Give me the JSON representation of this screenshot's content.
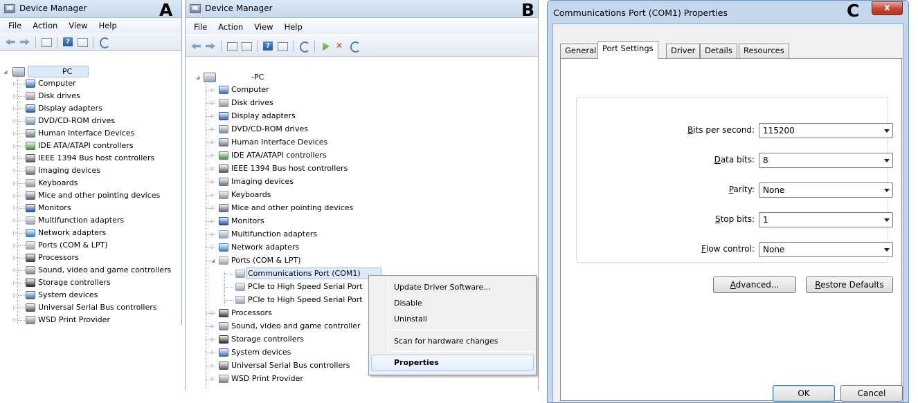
{
  "panels": {
    "a": {
      "letter": "A",
      "title": "Device Manager"
    },
    "b": {
      "letter": "B",
      "title": "Device Manager"
    },
    "c": {
      "letter": "C",
      "title": "Communications Port (COM1) Properties"
    }
  },
  "menu": [
    "File",
    "Action",
    "View",
    "Help"
  ],
  "tree_a": {
    "root": "PC",
    "items": [
      "Computer",
      "Disk drives",
      "Display adapters",
      "DVD/CD-ROM drives",
      "Human Interface Devices",
      "IDE ATA/ATAPI controllers",
      "IEEE 1394 Bus host controllers",
      "Imaging devices",
      "Keyboards",
      "Mice and other pointing devices",
      "Monitors",
      "Multifunction adapters",
      "Network adapters",
      "Ports (COM & LPT)",
      "Processors",
      "Sound, video and game controllers",
      "Storage controllers",
      "System devices",
      "Universal Serial Bus controllers",
      "WSD Print Provider"
    ]
  },
  "tree_b": {
    "root": "-PC",
    "items_before": [
      "Computer",
      "Disk drives",
      "Display adapters",
      "DVD/CD-ROM drives",
      "Human Interface Devices",
      "IDE ATA/ATAPI controllers",
      "IEEE 1394 Bus host controllers",
      "Imaging devices",
      "Keyboards",
      "Mice and other pointing devices",
      "Monitors",
      "Multifunction adapters",
      "Network adapters"
    ],
    "ports": "Ports (COM & LPT)",
    "port_children": [
      "Communications Port (COM1)",
      "PCIe to High Speed Serial Port",
      "PCIe to High Speed Serial Port"
    ],
    "items_after": [
      "Processors",
      "Sound, video and game controller",
      "Storage controllers",
      "System devices",
      "Universal Serial Bus controllers",
      "WSD Print Provider"
    ]
  },
  "context_menu": {
    "update": "Update Driver Software...",
    "disable": "Disable",
    "uninstall": "Uninstall",
    "scan": "Scan for hardware changes",
    "properties": "Properties"
  },
  "dialog": {
    "tabs": [
      "General",
      "Port Settings",
      "Driver",
      "Details",
      "Resources"
    ],
    "active_tab": "Port Settings",
    "fields": [
      {
        "key": "B",
        "rest": "its per second:",
        "value": "115200"
      },
      {
        "key": "D",
        "rest": "ata bits:",
        "value": "8"
      },
      {
        "key": "P",
        "rest": "arity:",
        "value": "None"
      },
      {
        "key": "S",
        "rest": "top bits:",
        "value": "1"
      },
      {
        "key": "F",
        "rest": "low control:",
        "value": "None"
      }
    ],
    "advanced_key": "A",
    "advanced_rest": "dvanced...",
    "restore_key": "R",
    "restore_rest": "estore Defaults",
    "ok": "OK",
    "cancel": "Cancel"
  },
  "colors": {
    "computer": "#3b6db3",
    "disk": "#8a8f96",
    "display": "#2f5fa8",
    "dvd": "#7d8c99",
    "hid": "#6b7a88",
    "ide": "#4a8c4a",
    "ieee": "#5c5c5c",
    "imaging": "#6a7684",
    "keyboard": "#8d949c",
    "mouse": "#5d6670",
    "monitor": "#1f4fa0",
    "multi": "#97a3b0",
    "network": "#3a7bc8",
    "ports": "#9aa5b1",
    "cpu": "#3b3b3b",
    "sound": "#7c8794",
    "storage": "#2d2d2d",
    "system": "#3b6db3",
    "usb": "#595959",
    "wsd": "#7a8490"
  }
}
